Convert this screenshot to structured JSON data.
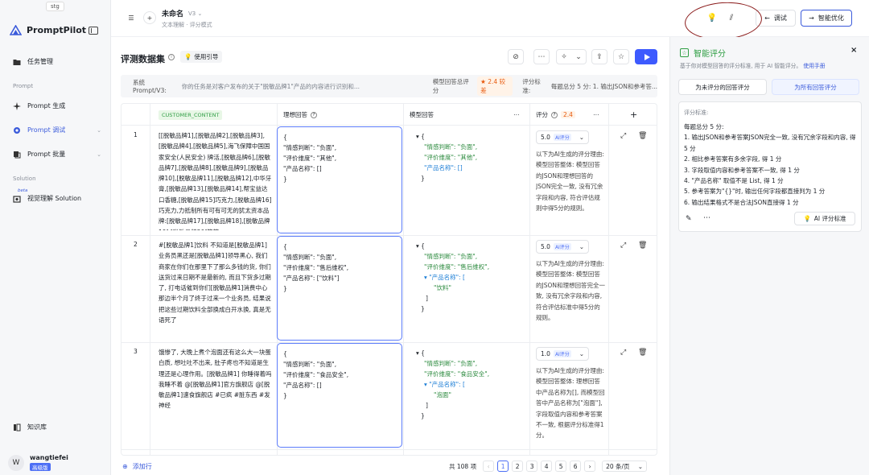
{
  "env_tag": "stg",
  "brand": {
    "name": "PromptPilot"
  },
  "sidebar": {
    "items": [
      {
        "label": "任务管理"
      },
      {
        "label": "Prompt 生成"
      },
      {
        "label": "Prompt 调试"
      },
      {
        "label": "Prompt 批量"
      },
      {
        "label": "视觉理解 Solution"
      },
      {
        "label": "知识库"
      }
    ],
    "sections": [
      "Prompt",
      "Solution"
    ],
    "beta": "beta"
  },
  "user": {
    "initial": "W",
    "name": "wangtiefei",
    "badge": "高级版"
  },
  "topbar": {
    "title": "未命名",
    "version": "V3",
    "subtitle": "文本理解 · 评分模式",
    "debug_label": "调试",
    "optimize_label": "智能优化"
  },
  "main": {
    "title": "评测数据集",
    "guide_label": "使用引导",
    "system_prompt_label": "系统 Prompt/V3:",
    "system_prompt_text": "你的任务是对客户发布的关于\"脱敏品牌1\"产品的内容进行识别和...",
    "model_score_label": "模型回答总评分",
    "model_score_value": "2.4 较差",
    "criteria_label": "评分标准:",
    "criteria_text": "每题总分 5 分:  1. 输出JSON和参考答..."
  },
  "table": {
    "headers": {
      "customer": "CUSTOMER_CONTENT",
      "ideal": "理想回答",
      "model": "模型回答",
      "score": "评分",
      "score_avg": "2.4"
    },
    "rows": [
      {
        "num": "1",
        "content": "[[脱敏品牌1],[脱敏品牌2],[脱敏品牌3],[脱敏品牌4],[脱敏品牌5],海飞保障中国国家安全(人民安全) 牌活,[脱敏品牌6],[脱敏品牌7],[脱敏品牌8],[脱敏品牌9],[脱敏品牌10],[脱敏品牌11],[脱敏品牌12],中华牙膏,[脱敏品牌13],[脱敏品牌14],帮宝益达口香糖,[脱敏品牌15]巧克力,[脱敏品牌16]巧克力,力抵制所有可有可无的犹太资本品牌:[脱敏品牌17],[脱敏品牌18],[脱敏品牌19],[脱敏品牌20]等等",
        "ideal": [
          "{",
          "\"情感判断\": \"负面\",",
          "\"评价维度\": \"其他\",",
          "\"产品名称\": []",
          "}"
        ],
        "model_lines": [
          {
            "t": "▾ {",
            "c": ""
          },
          {
            "t": "\"情感判断\": \"负面\",",
            "c": "kv"
          },
          {
            "t": "\"评价维度\": \"其他\",",
            "c": "kv"
          },
          {
            "t": "\"产品名称\": []",
            "c": "kb"
          },
          {
            "t": "}",
            "c": ""
          }
        ],
        "score": "5.0",
        "ai_tag": "AI评分",
        "eval": "以下为AI生成的评分理由:\n模型回答整体: 模型回答的JSON和理想回答的JSON完全一致, 没有冗余字段和内容, 符合评估规则中得5分的规则。"
      },
      {
        "num": "2",
        "content": "#[脱敏品牌1]饮料 不知道是[脱敏品牌1]业务员黑还是[脱敏品牌1]领导黑心, 我们商家在你们在那里下了那么多钱的货, 你们送货过来日期不是最新的, 而且下货多过期了, 打电话催到你们[脱敏品牌1]消费中心那边半个月了终于过来一个业务员, 结果说把这些过期饮料全部换成白开水换, 真是无语死了",
        "ideal": [
          "{",
          "\"情感判断\": \"负面\",",
          "\"评价维度\": \"售后维权\",",
          "\"产品名称\": [\"饮料\"]",
          "}"
        ],
        "model_lines": [
          {
            "t": "▾ {",
            "c": ""
          },
          {
            "t": "\"情感判断\": \"负面\",",
            "c": "kv"
          },
          {
            "t": "\"评价维度\": \"售后维权\",",
            "c": "kv"
          },
          {
            "t": "▾ \"产品名称\": [",
            "c": "kb"
          },
          {
            "t": "\"饮料\"",
            "c": "v2"
          },
          {
            "t": "]",
            "c": "br"
          },
          {
            "t": "}",
            "c": ""
          }
        ],
        "score": "5.0",
        "ai_tag": "AI评分",
        "eval": "以下为AI生成的评分理由:\n模型回答整体: 模型回答的JSON和理想回答完全一致, 没有冗余字段和内容, 符合评估标准中得5分的规则。"
      },
      {
        "num": "3",
        "content": "饿惨了, 大晚上煮个泡面还有这么大一块蛋白质, 想吐吐不出来, 肚子疼也不知道是生理还是心理作用。[脱敏品牌1] 你睡得着吗我睡不着 @[脱敏品牌1]官方旗舰店 @[脱敏品牌1]速食旗舰店 #已疯 #脏东西 #发神经",
        "ideal": [
          "{",
          "\"情感判断\": \"负面\",",
          "\"评价维度\": \"食品安全\",",
          "\"产品名称\": []",
          "}"
        ],
        "model_lines": [
          {
            "t": "▾ {",
            "c": ""
          },
          {
            "t": "\"情感判断\": \"负面\",",
            "c": "kv"
          },
          {
            "t": "\"评价维度\": \"食品安全\",",
            "c": "kv"
          },
          {
            "t": "▾ \"产品名称\": [",
            "c": "kb"
          },
          {
            "t": "\"泡面\"",
            "c": "v2"
          },
          {
            "t": "]",
            "c": "br"
          },
          {
            "t": "}",
            "c": ""
          }
        ],
        "score": "1.0",
        "ai_tag": "AI评分",
        "eval": "以下为AI生成的评分理由:\n模型回答整体: 理想回答中产品名称为[], 而模型回答中产品名称为[\"泡面\"], 字段取值内容和参考答案不一致, 根据评分标准得1分。"
      }
    ]
  },
  "footer": {
    "add_label": "添加行",
    "total": "共 108 项",
    "pages": [
      "1",
      "2",
      "3",
      "4",
      "5",
      "6"
    ],
    "current_page": "1",
    "page_size": "20 条/页"
  },
  "rpanel": {
    "title": "智能评分",
    "desc": "基于你对模型回答的评分标准, 用于 AI 智能评分。",
    "desc_link": "使用手册",
    "btn_unscored": "为未评分的回答评分",
    "btn_all": "为所有回答评分",
    "criteria_label": "评分标准:",
    "criteria_lines": [
      "每题总分 5 分:",
      "1. 输出JSON和参考答案JSON完全一致, 没有冗余字段和内容, 得 5 分",
      "2. 相比参考答案有多余字段, 得 1 分",
      "3. 字段取值内容和参考答案不一致, 得 1 分",
      "4. \"产品名称\" 取值不是 List, 得 1 分",
      "5. 参考答案为\"{}\"时, 输出任何字段都直接判为 1 分",
      "6. 输出结果格式不是合法JSON直接得 1 分"
    ],
    "ai_btn": "AI 评分标准"
  },
  "colors": {
    "accent": "#3d5afe",
    "green": "#2f9e44",
    "annotation": "#8a1a1a"
  }
}
